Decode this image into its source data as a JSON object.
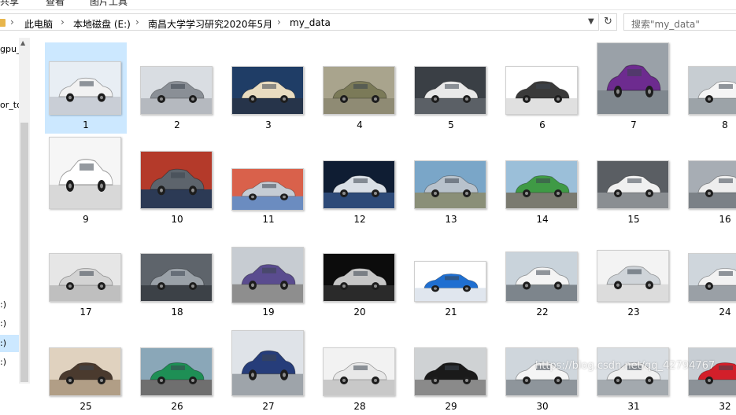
{
  "ribbon": {
    "tabs": [
      "共享",
      "查看",
      "图片工具"
    ]
  },
  "address": {
    "breadcrumb": [
      "此电脑",
      "本地磁盘 (E:)",
      "南昌大学学习研究2020年5月",
      "my_data"
    ],
    "search_placeholder": "搜索\"my_data\""
  },
  "nav": {
    "items": [
      "gpu_",
      "or_to",
      ":)",
      ":)",
      ":)",
      ":)"
    ],
    "selected_index": 4
  },
  "files": [
    {
      "name": "1",
      "bg": "#e8eef4",
      "car": "#f2f2f2",
      "ground": "#c9ced6"
    },
    {
      "name": "2",
      "bg": "#d9dde2",
      "car": "#8a8f96",
      "ground": "#b5b9bf"
    },
    {
      "name": "3",
      "bg": "#1f3d66",
      "car": "#e9dcc0",
      "ground": "#26344a"
    },
    {
      "name": "4",
      "bg": "#a9a48d",
      "car": "#7b7a58",
      "ground": "#8f8b74"
    },
    {
      "name": "5",
      "bg": "#3a3f45",
      "car": "#e8e8e8",
      "ground": "#5b6066"
    },
    {
      "name": "6",
      "bg": "#ffffff",
      "car": "#3a3a3a",
      "ground": "#e0e0e0"
    },
    {
      "name": "7",
      "bg": "#9aa1a8",
      "car": "#6d2b8f",
      "ground": "#7f878e"
    },
    {
      "name": "8",
      "bg": "#c7cdd2",
      "car": "#f5f5f5",
      "ground": "#9ca3a8"
    },
    {
      "name": "9",
      "bg": "#f6f6f6",
      "car": "#ffffff",
      "ground": "#d8d8d8"
    },
    {
      "name": "10",
      "bg": "#b43a2a",
      "car": "#5d646c",
      "ground": "#2c3a55"
    },
    {
      "name": "11",
      "bg": "#d9614b",
      "car": "#c5ccd4",
      "ground": "#6b8cc0"
    },
    {
      "name": "12",
      "bg": "#0f1d33",
      "car": "#d9dfe6",
      "ground": "#2d4a78"
    },
    {
      "name": "13",
      "bg": "#7aa6c8",
      "car": "#b8c2cc",
      "ground": "#8a8f78"
    },
    {
      "name": "14",
      "bg": "#9bbfd9",
      "car": "#3f9a45",
      "ground": "#7a7a70"
    },
    {
      "name": "15",
      "bg": "#5a5e63",
      "car": "#f0f0f0",
      "ground": "#8a8e92"
    },
    {
      "name": "16",
      "bg": "#a7adb4",
      "car": "#eeeeee",
      "ground": "#7b8187"
    },
    {
      "name": "17",
      "bg": "#e6e6e6",
      "car": "#d3d3d3",
      "ground": "#bfbfbf"
    },
    {
      "name": "18",
      "bg": "#5e646b",
      "car": "#9aa1a8",
      "ground": "#3c4147"
    },
    {
      "name": "19",
      "bg": "#c7ccd2",
      "car": "#5a4c8f",
      "ground": "#8e8e8e"
    },
    {
      "name": "20",
      "bg": "#0c0c0c",
      "car": "#c6c6c6",
      "ground": "#2a2a2a"
    },
    {
      "name": "21",
      "bg": "#ffffff",
      "car": "#1f6fd1",
      "ground": "#e0e6ee"
    },
    {
      "name": "22",
      "bg": "#c9d3db",
      "car": "#f4f4f4",
      "ground": "#7d858c"
    },
    {
      "name": "23",
      "bg": "#f3f3f3",
      "car": "#cfd4d9",
      "ground": "#dcdcdc"
    },
    {
      "name": "24",
      "bg": "#cfd6dc",
      "car": "#f2f2f2",
      "ground": "#9aa0a6"
    },
    {
      "name": "25",
      "bg": "#e0d2bf",
      "car": "#4a3a2e",
      "ground": "#b19e86"
    },
    {
      "name": "26",
      "bg": "#8aa7b8",
      "car": "#1e8f55",
      "ground": "#6f6f6f"
    },
    {
      "name": "27",
      "bg": "#dfe3e8",
      "car": "#263d7a",
      "ground": "#9ea4aa"
    },
    {
      "name": "28",
      "bg": "#f2f2f2",
      "car": "#e8e8e8",
      "ground": "#c8c8c8"
    },
    {
      "name": "29",
      "bg": "#cfd2d4",
      "car": "#1a1a1a",
      "ground": "#8a8a8a"
    },
    {
      "name": "30",
      "bg": "#cfd6dc",
      "car": "#f5f5f5",
      "ground": "#8e959b"
    },
    {
      "name": "31",
      "bg": "#d8dde2",
      "car": "#f0f0f0",
      "ground": "#a3a9ae"
    },
    {
      "name": "32",
      "bg": "#c8ced4",
      "car": "#d21f2a",
      "ground": "#8b9197"
    }
  ],
  "watermark": "https://blog.csdn.net/qq_42794767"
}
